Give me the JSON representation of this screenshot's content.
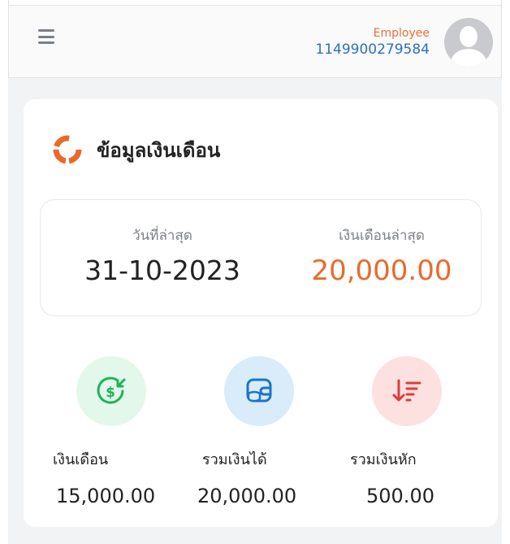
{
  "header": {
    "user_role": "Employee",
    "user_id": "1149900279584"
  },
  "card": {
    "title": "ข้อมูลเงินเดือน",
    "latest_date_label": "วันที่ล่าสุด",
    "latest_date": "31-10-2023",
    "latest_salary_label": "เงินเดือนล่าสุด",
    "latest_salary": "20,000.00"
  },
  "stats": [
    {
      "label": "เงินเดือน",
      "value": "15,000.00",
      "icon": "salary-dollar-icon",
      "color": "#1fb35a",
      "bg": "#e3f8ea"
    },
    {
      "label": "รวมเงินได้",
      "value": "20,000.00",
      "icon": "wallet-coins-icon",
      "color": "#1b74c9",
      "bg": "#d8ecfa"
    },
    {
      "label": "รวมเงินหัก",
      "value": "500.00",
      "icon": "sort-down-icon",
      "color": "#e23b3b",
      "bg": "#fde1e1"
    }
  ],
  "colors": {
    "accent_orange": "#ea6a2c",
    "id_blue": "#2d6fc2"
  }
}
